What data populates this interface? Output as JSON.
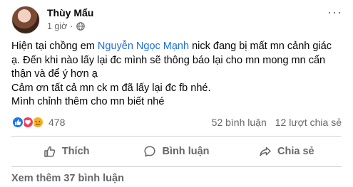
{
  "post": {
    "author": "Thùy Mẩu",
    "time": "1 giờ",
    "separator": "·",
    "more_label": "···",
    "text": {
      "line1_before": "Hiện tại chồng em ",
      "mention": "Nguyễn Ngọc Mạnh",
      "line1_after": "  nick đang bị mất mn cảnh giác ạ. Đến khi nào lấy lại đc mình sẽ thông báo lại cho mn mong mn cẩn thận và để ý hơn ạ",
      "line2": "Cảm ơn tất cả mn ck m đã lấy lại đc fb nhé.",
      "line3": "Mình chỉnh thêm cho mn biết nhé"
    }
  },
  "stats": {
    "reactions_count": "478",
    "comments": "52 bình luận",
    "shares": "12 lượt chia sẻ",
    "reaction_types": [
      "like-icon",
      "love-icon",
      "sad-icon"
    ]
  },
  "actions": {
    "like": "Thích",
    "comment": "Bình luận",
    "share": "Chia sẻ"
  },
  "comments": {
    "view_more": "Xem thêm 37 bình luận"
  },
  "colors": {
    "mention": "#216fdb",
    "like": "#1877f2",
    "love": "#f33e58",
    "sad": "#f7b125",
    "muted_text": "#65676b"
  }
}
